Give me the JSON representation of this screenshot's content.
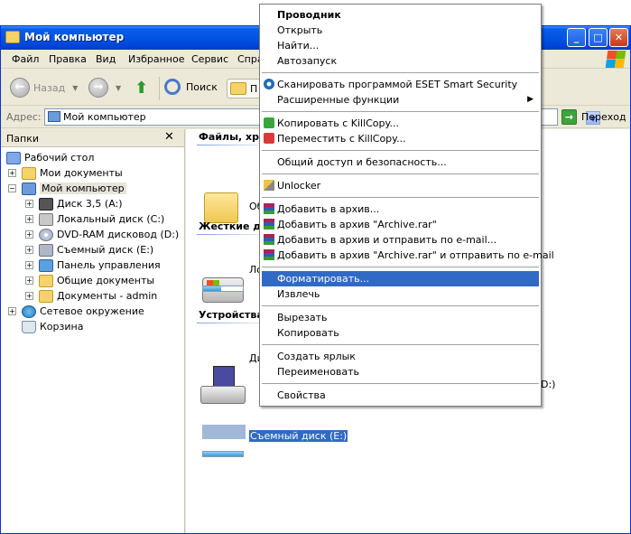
{
  "window": {
    "title": "Мой компьютер"
  },
  "menubar": [
    "Файл",
    "Правка",
    "Вид",
    "Избранное",
    "Сервис",
    "Спра"
  ],
  "toolbar": {
    "back_label": "Назад",
    "search_label": "Поиск",
    "folders_label": "П"
  },
  "address": {
    "label": "Адрес:",
    "value": "Мой компьютер",
    "go_label": "Переход"
  },
  "folders_pane": {
    "title": "Папки",
    "close_glyph": "✕",
    "items": [
      {
        "label": "Рабочий стол",
        "icon": "desktop-icon"
      },
      {
        "label": "Мои документы",
        "icon": "my-documents-icon"
      },
      {
        "label": "Мой компьютер",
        "icon": "computer-icon"
      },
      {
        "label": "Диск 3,5 (A:)",
        "icon": "floppy-icon"
      },
      {
        "label": "Локальный диск (C:)",
        "icon": "hard-disk-icon"
      },
      {
        "label": "DVD-RAM дисковод (D:)",
        "icon": "dvd-icon"
      },
      {
        "label": "Съемный диск (E:)",
        "icon": "removable-disk-icon"
      },
      {
        "label": "Панель управления",
        "icon": "control-panel-icon"
      },
      {
        "label": "Общие документы",
        "icon": "folder-icon"
      },
      {
        "label": "Документы - admin",
        "icon": "folder-icon"
      },
      {
        "label": "Сетевое окружение",
        "icon": "network-icon"
      },
      {
        "label": "Корзина",
        "icon": "recycle-bin-icon"
      }
    ]
  },
  "content": {
    "group_files": "Файлы, хра",
    "group_hdd": "Жесткие ди",
    "group_devices": "Устройства",
    "shared_item": "Об",
    "local_disk_item": "Ло",
    "floppy_item": "Ди",
    "dvd_tail": "D:)",
    "removable_item": "Съемный диск (E:)"
  },
  "context_menu": {
    "items": [
      {
        "label": "Проводник",
        "bold": true
      },
      {
        "label": "Открыть"
      },
      {
        "label": "Найти..."
      },
      {
        "label": "Автозапуск"
      },
      {
        "label": "Сканировать программой ESET Smart Security",
        "icon": "eset-icon"
      },
      {
        "label": "Расширенные функции",
        "submenu": true
      },
      {
        "label": "Копировать с KillCopy...",
        "icon": "killcopy-copy-icon"
      },
      {
        "label": "Переместить с KillCopy...",
        "icon": "killcopy-move-icon"
      },
      {
        "label": "Общий доступ и безопасность..."
      },
      {
        "label": "Unlocker",
        "icon": "unlocker-icon"
      },
      {
        "label": "Добавить в архив...",
        "icon": "winrar-icon"
      },
      {
        "label": "Добавить в архив \"Archive.rar\"",
        "icon": "winrar-icon"
      },
      {
        "label": "Добавить в архив и отправить по e-mail...",
        "icon": "winrar-icon"
      },
      {
        "label": "Добавить в архив \"Archive.rar\" и отправить по e-mail",
        "icon": "winrar-icon"
      },
      {
        "label": "Форматировать...",
        "highlighted": true
      },
      {
        "label": "Извлечь"
      },
      {
        "label": "Вырезать"
      },
      {
        "label": "Копировать"
      },
      {
        "label": "Создать ярлык"
      },
      {
        "label": "Переименовать"
      },
      {
        "label": "Свойства"
      }
    ]
  },
  "colors": {
    "titlebar": "#0054e3",
    "selection": "#316ac5",
    "window_bg": "#ece9d8"
  }
}
